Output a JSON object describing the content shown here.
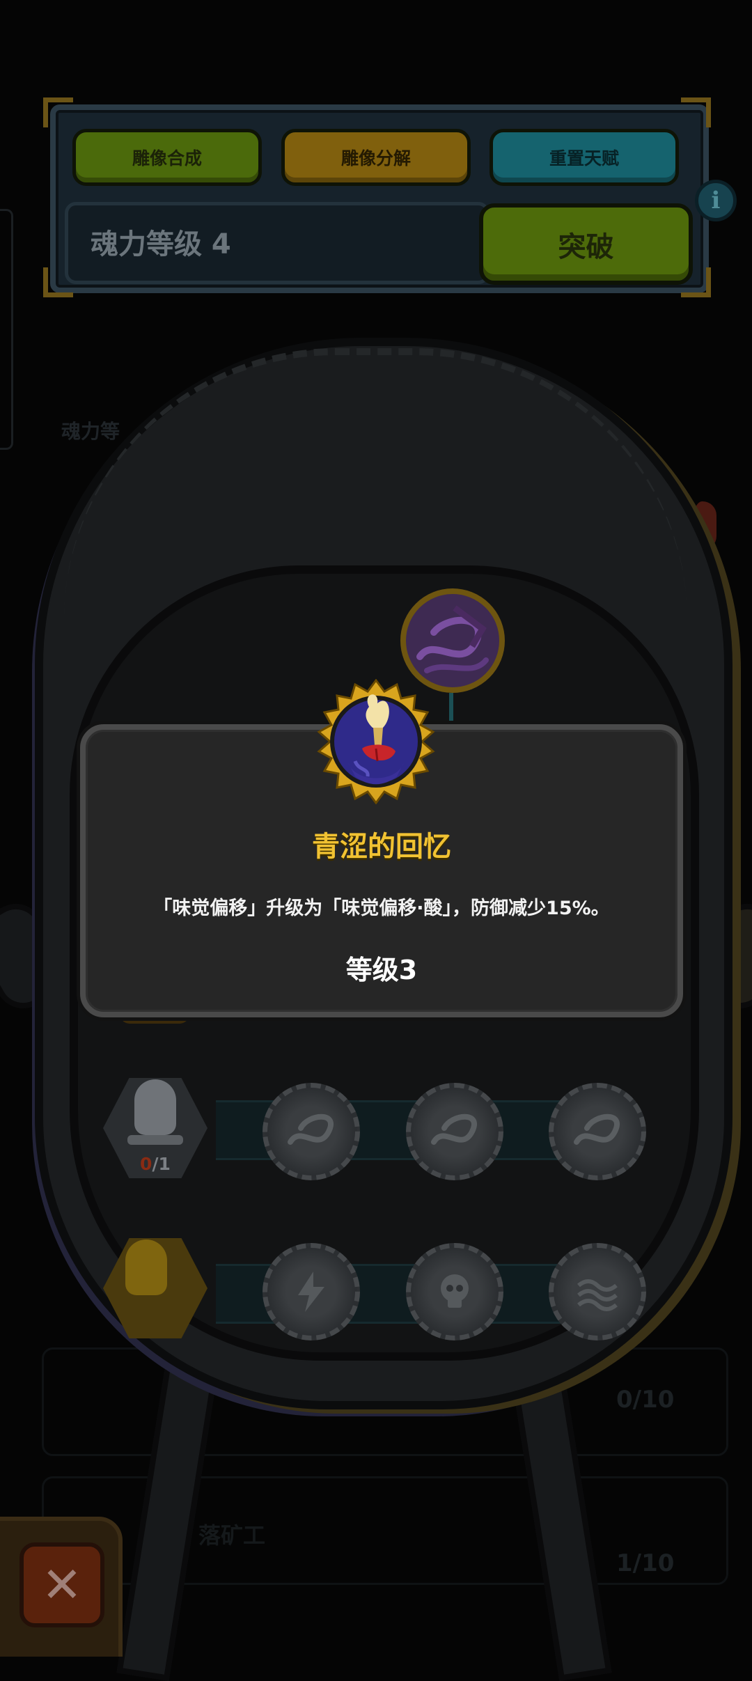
{
  "header": {
    "btn_synth": "雕像合成",
    "btn_decompose": "雕像分解",
    "btn_reset": "重置天赋",
    "soul_level": "魂力等级 4",
    "btn_breakthrough": "突破",
    "info_glyph": "i"
  },
  "background": {
    "faint_label": "魂力等",
    "faint_name": "落矿工",
    "row_count_1": "0/10",
    "row_count_2": "1/10"
  },
  "statue_rows": [
    {
      "count_have": "0",
      "count_sep_total": "/1"
    }
  ],
  "popup": {
    "title": "青涩的回忆",
    "description": "「味觉偏移」升级为「味觉偏移·酸」，防御减少15%。",
    "level": "等级3"
  },
  "close_glyph": "✕",
  "colors": {
    "title_gold": "#f1c232",
    "accent_green": "#4d6b0a",
    "accent_orange": "#80600d",
    "accent_cyan": "#15636e"
  }
}
